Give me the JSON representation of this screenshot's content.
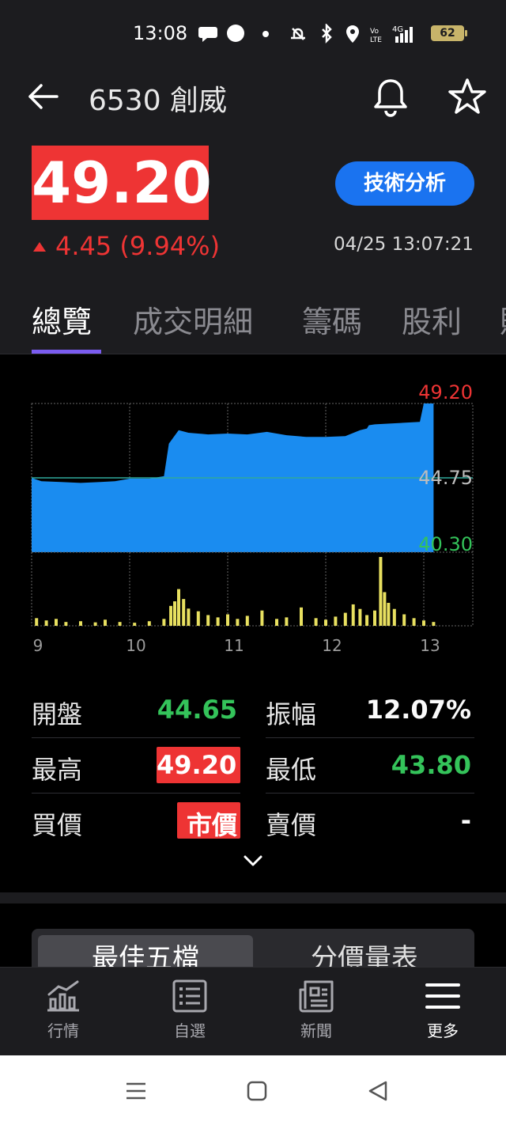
{
  "status_bar": {
    "time": "13:08",
    "battery": "62"
  },
  "header": {
    "title": "6530 創威",
    "price": "49.20",
    "change": "4.45 (9.94%)",
    "timestamp": "04/25 13:07:21",
    "tech_button": "技術分析"
  },
  "tabs": [
    {
      "label": "總覽",
      "active": true
    },
    {
      "label": "成交明細",
      "active": false
    },
    {
      "label": "籌碼",
      "active": false
    },
    {
      "label": "股利",
      "active": false
    }
  ],
  "chart_data": {
    "type": "area",
    "y_labels": {
      "high": "49.20",
      "ref": "44.75",
      "low": "40.30"
    },
    "ylim": [
      40.3,
      49.2
    ],
    "reference": 44.75,
    "x_ticks": [
      "9",
      "10",
      "11",
      "12",
      "13"
    ],
    "x_range": [
      9.0,
      13.5
    ],
    "price_series": {
      "x": [
        9.0,
        9.1,
        9.3,
        9.5,
        9.7,
        9.85,
        10.0,
        10.2,
        10.35,
        10.4,
        10.5,
        10.6,
        10.8,
        11.0,
        11.2,
        11.4,
        11.6,
        11.8,
        12.0,
        12.2,
        12.35,
        12.42,
        12.44,
        12.5,
        12.96,
        13.0,
        13.1
      ],
      "y": [
        44.75,
        44.55,
        44.5,
        44.45,
        44.5,
        44.55,
        44.7,
        44.7,
        44.85,
        46.8,
        47.6,
        47.45,
        47.35,
        47.4,
        47.35,
        47.5,
        47.3,
        47.2,
        47.2,
        47.25,
        47.6,
        47.7,
        47.9,
        47.95,
        48.1,
        49.2,
        49.2
      ]
    },
    "volume_series": {
      "x": [
        9.05,
        9.15,
        9.25,
        9.35,
        9.5,
        9.65,
        9.75,
        9.9,
        10.05,
        10.2,
        10.35,
        10.42,
        10.46,
        10.5,
        10.55,
        10.6,
        10.7,
        10.8,
        10.9,
        11.0,
        11.1,
        11.2,
        11.35,
        11.5,
        11.6,
        11.75,
        11.9,
        12.0,
        12.1,
        12.2,
        12.28,
        12.35,
        12.42,
        12.5,
        12.56,
        12.6,
        12.64,
        12.7,
        12.8,
        12.9,
        13.0,
        13.1
      ],
      "y": [
        20,
        14,
        18,
        10,
        12,
        9,
        16,
        10,
        8,
        12,
        18,
        52,
        64,
        96,
        70,
        45,
        38,
        28,
        22,
        30,
        18,
        26,
        40,
        18,
        22,
        48,
        20,
        16,
        24,
        34,
        56,
        44,
        28,
        40,
        180,
        88,
        60,
        44,
        30,
        20,
        14,
        10
      ]
    }
  },
  "stats": {
    "open_label": "開盤",
    "open_value": "44.65",
    "amplitude_label": "振幅",
    "amplitude_value": "12.07%",
    "high_label": "最高",
    "high_value": "49.20",
    "low_label": "最低",
    "low_value": "43.80",
    "bid_label": "買價",
    "bid_value": "市價",
    "ask_label": "賣價",
    "ask_value": "-"
  },
  "quote_tabs": [
    "最佳五檔",
    "分價量表"
  ],
  "bottom_nav": [
    {
      "label": "行情",
      "icon": "chart-icon",
      "active": false
    },
    {
      "label": "自選",
      "icon": "watchlist-icon",
      "active": false
    },
    {
      "label": "新聞",
      "icon": "news-icon",
      "active": false
    },
    {
      "label": "更多",
      "icon": "menu-icon",
      "active": true
    }
  ],
  "colors": {
    "up": "#ee3434",
    "down": "#34c35a",
    "area_fill": "#1a8cf0",
    "volume": "#e8e060",
    "accent": "#7a5cf0",
    "button": "#1a73f0"
  }
}
